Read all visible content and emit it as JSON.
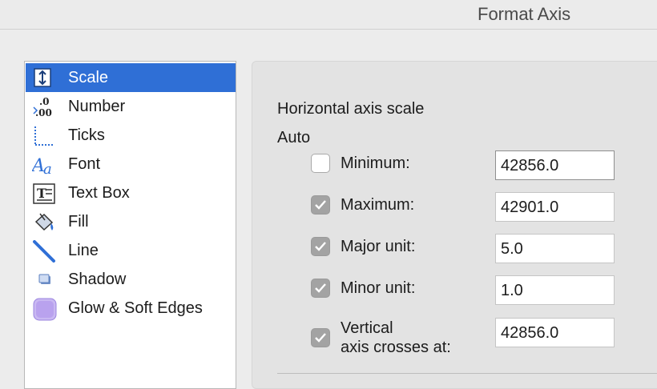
{
  "window": {
    "title": "Format Axis"
  },
  "sidebar": {
    "items": [
      {
        "label": "Scale",
        "icon": "scale-icon",
        "selected": true
      },
      {
        "label": "Number",
        "icon": "number-format-icon",
        "selected": false
      },
      {
        "label": "Ticks",
        "icon": "ticks-icon",
        "selected": false
      },
      {
        "label": "Font",
        "icon": "font-icon",
        "selected": false
      },
      {
        "label": "Text Box",
        "icon": "text-box-icon",
        "selected": false
      },
      {
        "label": "Fill",
        "icon": "paint-bucket-icon",
        "selected": false
      },
      {
        "label": "Line",
        "icon": "line-icon",
        "selected": false
      },
      {
        "label": "Shadow",
        "icon": "shadow-icon",
        "selected": false
      },
      {
        "label": "Glow & Soft Edges",
        "icon": "glow-icon",
        "selected": false
      }
    ],
    "selected_color": "#2f6fd6"
  },
  "scale": {
    "section_title": "Horizontal axis scale",
    "auto_label": "Auto",
    "rows": [
      {
        "label": "Minimum:",
        "auto": false,
        "value": "42856.0"
      },
      {
        "label": "Maximum:",
        "auto": true,
        "value": "42901.0"
      },
      {
        "label": "Major unit:",
        "auto": true,
        "value": "5.0"
      },
      {
        "label": "Minor unit:",
        "auto": true,
        "value": "1.0"
      },
      {
        "label_line1": "Vertical",
        "label_line2": "axis crosses at:",
        "auto": true,
        "value": "42856.0"
      }
    ]
  }
}
